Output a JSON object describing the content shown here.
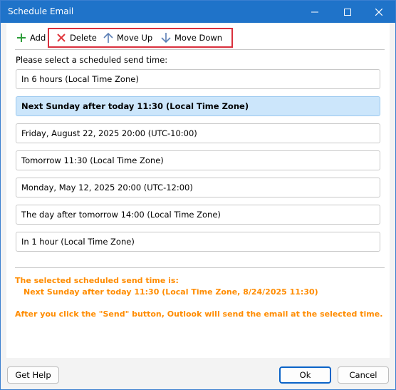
{
  "window": {
    "title": "Schedule Email"
  },
  "toolbar": {
    "add_label": "Add",
    "delete_label": "Delete",
    "move_up_label": "Move Up",
    "move_down_label": "Move Down"
  },
  "prompt": "Please select a scheduled send time:",
  "options": [
    {
      "label": "In 6 hours (Local Time Zone)",
      "selected": false
    },
    {
      "label": "Next Sunday after today 11:30 (Local Time Zone)",
      "selected": true
    },
    {
      "label": "Friday, August 22, 2025 20:00 (UTC-10:00)",
      "selected": false
    },
    {
      "label": "Tomorrow 11:30 (Local Time Zone)",
      "selected": false
    },
    {
      "label": "Monday, May 12, 2025 20:00 (UTC-12:00)",
      "selected": false
    },
    {
      "label": "The day after tomorrow 14:00 (Local Time Zone)",
      "selected": false
    },
    {
      "label": "In 1 hour (Local Time Zone)",
      "selected": false
    }
  ],
  "info": {
    "selected_heading": "The selected scheduled send time is:",
    "selected_value": "Next Sunday after today 11:30 (Local Time Zone, 8/24/2025 11:30)",
    "note": "After you click the \"Send\" button, Outlook will send the email at the selected time."
  },
  "footer": {
    "help_label": "Get Help",
    "ok_label": "Ok",
    "cancel_label": "Cancel"
  },
  "colors": {
    "titlebar": "#1f73c9",
    "selection": "#cce6fb",
    "info_text": "#ff8c00",
    "highlight_box": "#d9303d",
    "add_icon": "#2e9d3a",
    "delete_icon": "#e0383e",
    "arrow_icon": "#5b7fb5"
  }
}
